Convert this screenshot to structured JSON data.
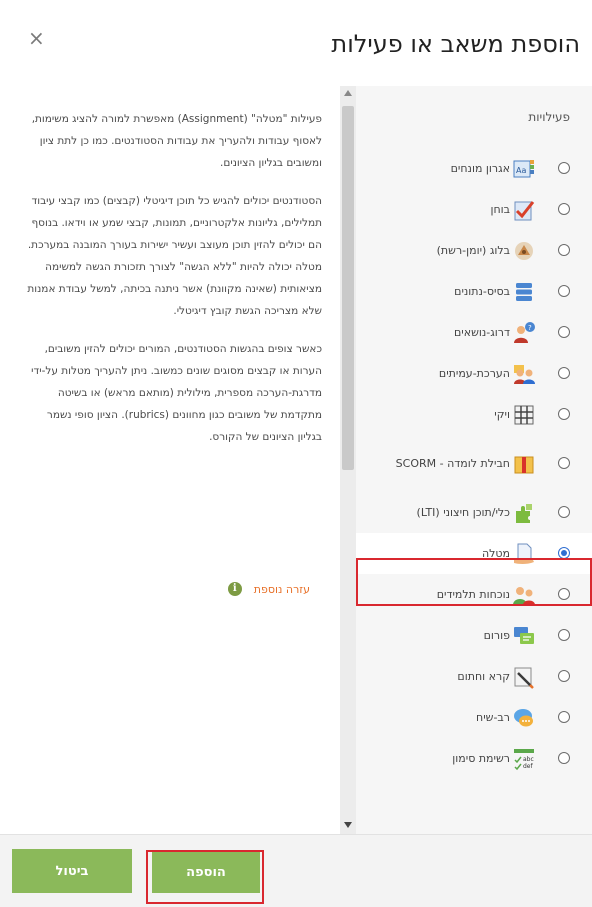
{
  "dialog": {
    "title": "הוספת משאב או פעילות",
    "close_glyph": "×"
  },
  "help": {
    "paragraphs": [
      "פעילות \"מטלה\" (Assignment) מאפשרת למורה להציג משימות, לאסוף עבודות ולהעריך את עבודות הסטודנטים. כמו כן לתת ציון ומשובים בגליון הציונים.",
      "הסטודנטים יכולים להגיש כל תוכן דיגיטלי (קבצים) כמו קבצי עיבוד תמלילים, גליונות אלקטרוניים, תמונות, קבצי שמע או וידאו. בנוסף הם יכולים להזין תוכן מעוצב ועשיר ישירות בעורך המובנה במערכת. מטלה יכולה להיות \"ללא הגשה\" לצורך תזכורת הגשה למשימה מציאותית (שאינה מקוונת) אשר ניתנה בכיתה, למשל עבודת אמנות שלא מצריכה הגשת קובץ דיגיטלי.",
      "כאשר צופים בהגשות הסטודנטים, המורים יכולים להזין משובים, הערות או קבצים מסוגים שונים כמשוב. ניתן להעריך מטלות על-ידי מדרגת-הערכה מספרית, מילולית (מותאם מראש) או בשיטה מתקדמת של משובים כגון מחוונים (rubrics). הציון סופי נשמר בגליון הציונים של הקורס."
    ],
    "more_help": "עזרה נוספת",
    "info_icon": "i"
  },
  "activities": {
    "section_title": "פעילויות",
    "items": [
      {
        "label": "אגרון מונחים",
        "icon": "glossary-icon",
        "selected": false
      },
      {
        "label": "בוחן",
        "icon": "quiz-icon",
        "selected": false
      },
      {
        "label": "בלוג (יומן-רשת)",
        "icon": "blog-icon",
        "selected": false
      },
      {
        "label": "בסיס-נתונים",
        "icon": "database-icon",
        "selected": false
      },
      {
        "label": "דרוג-נושאים",
        "icon": "topic-rating-icon",
        "selected": false
      },
      {
        "label": "הערכת-עמיתים",
        "icon": "peer-review-icon",
        "selected": false
      },
      {
        "label": "ויקי",
        "icon": "wiki-icon",
        "selected": false
      },
      {
        "label": "חבילת לומדה - SCORM",
        "icon": "scorm-package-icon",
        "selected": false
      },
      {
        "label": "כלי/תוכן חיצוני (LTI)",
        "icon": "lti-puzzle-icon",
        "selected": false
      },
      {
        "label": "מטלה",
        "icon": "assignment-icon",
        "selected": true
      },
      {
        "label": "נוכחות תלמידים",
        "icon": "attendance-icon",
        "selected": false
      },
      {
        "label": "פורום",
        "icon": "forum-icon",
        "selected": false
      },
      {
        "label": "קרא וחתום",
        "icon": "read-and-sign-icon",
        "selected": false
      },
      {
        "label": "רב-שיח",
        "icon": "chat-icon",
        "selected": false
      },
      {
        "label": "רשימת סימון",
        "icon": "checklist-icon",
        "selected": false
      }
    ]
  },
  "footer": {
    "cancel_label": "ביטול",
    "add_label": "הוספה"
  },
  "colors": {
    "button_green": "#8bb95a",
    "highlight_red": "#d9282f",
    "link_orange": "#e8722b",
    "radio_blue": "#2f6ed1"
  }
}
